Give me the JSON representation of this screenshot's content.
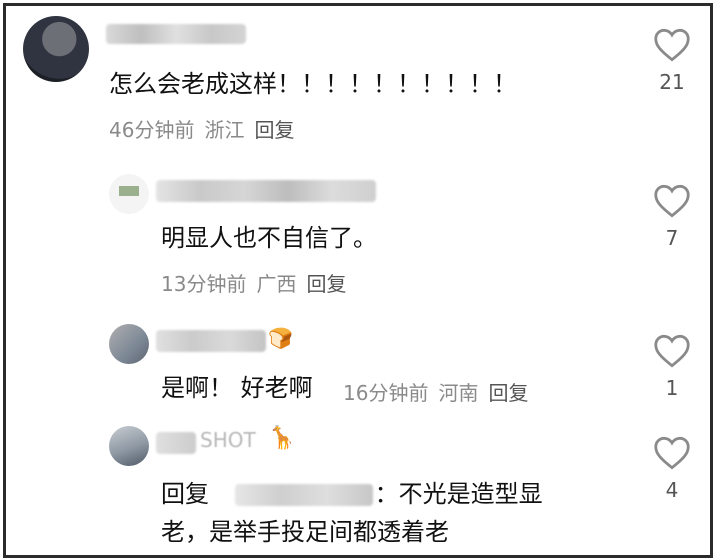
{
  "comments": [
    {
      "text": "怎么会老成这样！！！！！！！！！！",
      "time": "46分钟前",
      "location": "浙江",
      "reply_label": "回复",
      "likes": "21"
    },
    {
      "text": "明显人也不自信了。",
      "time": "13分钟前",
      "location": "广西",
      "reply_label": "回复",
      "likes": "7"
    },
    {
      "text": "是啊！ 好老啊",
      "time": "16分钟前",
      "location": "河南",
      "reply_label": "回复",
      "likes": "1",
      "name_emoji": "🍞"
    },
    {
      "username_visible": "SHOT",
      "reply_prefix": "回复",
      "reply_colon": "：",
      "text_line1": "不光是造型显",
      "text_line2": "老，是举手投足间都透着老",
      "likes": "4",
      "name_emoji": "🦒"
    }
  ],
  "colors": {
    "like_icon": "#8a8a8a",
    "meta": "#8a8a8a",
    "text": "#111111"
  },
  "icons": {
    "like": "heart-outline-icon"
  }
}
